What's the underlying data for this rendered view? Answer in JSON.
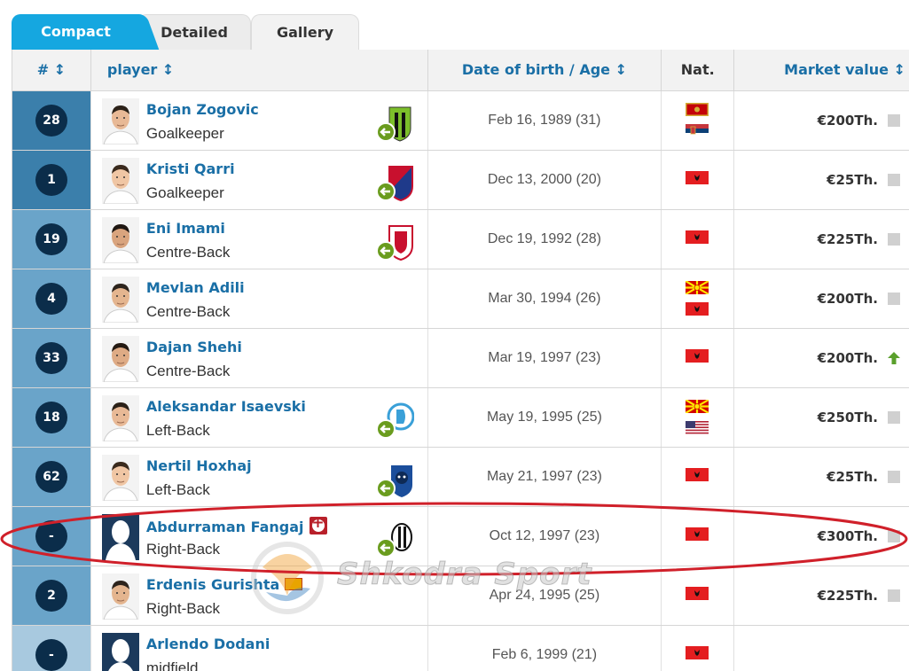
{
  "tabs": [
    {
      "label": "Compact",
      "active": true
    },
    {
      "label": "Detailed",
      "active": false
    },
    {
      "label": "Gallery",
      "active": false
    }
  ],
  "header": {
    "num": "# ↕",
    "player": "player ↕",
    "dob": "Date of birth / Age ↕",
    "nat": "Nat.",
    "mv": "Market value ↕"
  },
  "rows": [
    {
      "num": "28",
      "name": "Bojan Zogovic",
      "position": "Goalkeeper",
      "dob": "Feb 16, 1989 (31)",
      "value": "€200Th.",
      "num_bg": "#3b7fab",
      "flags": [
        "montenegro",
        "serbia"
      ],
      "club": "green-black-club-icon",
      "trend": "none"
    },
    {
      "num": "1",
      "name": "Kristi Qarri",
      "position": "Goalkeeper",
      "dob": "Dec 13, 2000 (20)",
      "value": "€25Th.",
      "num_bg": "#3b7fab",
      "flags": [
        "albania"
      ],
      "club": "red-blue-club-icon",
      "trend": "none"
    },
    {
      "num": "19",
      "name": "Eni Imami",
      "position": "Centre-Back",
      "dob": "Dec 19, 1992 (28)",
      "value": "€225Th.",
      "num_bg": "#6aa4c9",
      "flags": [
        "albania"
      ],
      "club": "red-white-club-icon",
      "trend": "none"
    },
    {
      "num": "4",
      "name": "Mevlan Adili",
      "position": "Centre-Back",
      "dob": "Mar 30, 1994 (26)",
      "value": "€200Th.",
      "num_bg": "#6aa4c9",
      "flags": [
        "north-macedonia",
        "albania"
      ],
      "club": "",
      "trend": "none"
    },
    {
      "num": "33",
      "name": "Dajan Shehi",
      "position": "Centre-Back",
      "dob": "Mar 19, 1997 (23)",
      "value": "€200Th.",
      "num_bg": "#6aa4c9",
      "flags": [
        "albania"
      ],
      "club": "",
      "trend": "up"
    },
    {
      "num": "18",
      "name": "Aleksandar Isaevski",
      "position": "Left-Back",
      "dob": "May 19, 1995 (25)",
      "value": "€250Th.",
      "num_bg": "#6aa4c9",
      "flags": [
        "north-macedonia",
        "usa"
      ],
      "club": "blue-white-club-icon",
      "trend": "none"
    },
    {
      "num": "62",
      "name": "Nertil Hoxhaj",
      "position": "Left-Back",
      "dob": "May 21, 1997 (23)",
      "value": "€25Th.",
      "num_bg": "#6aa4c9",
      "flags": [
        "albania"
      ],
      "club": "blue-panther-club-icon",
      "trend": "none"
    },
    {
      "num": "-",
      "name": "Abdurraman Fangaj",
      "position": "Right-Back",
      "dob": "Oct 12, 1997 (23)",
      "value": "€300Th.",
      "num_bg": "#6aa4c9",
      "flags": [
        "albania"
      ],
      "club": "black-white-club-icon",
      "trend": "none",
      "injury": true,
      "silhouette": true
    },
    {
      "num": "2",
      "name": "Erdenis Gurishta",
      "position": "Right-Back",
      "dob": "Apr 24, 1995 (25)",
      "value": "€225Th.",
      "num_bg": "#6aa4c9",
      "flags": [
        "albania"
      ],
      "club": "",
      "trend": "none",
      "small_flag": true
    },
    {
      "num": "-",
      "name": "Arlendo Dodani",
      "position": "midfield",
      "dob": "Feb 6, 1999 (21)",
      "value": "",
      "num_bg": "#a8c9df",
      "flags": [
        "albania"
      ],
      "club": "",
      "trend": "none",
      "silhouette": true
    }
  ],
  "watermark": {
    "text": "Shkodra Sport"
  },
  "colors": {
    "accent": "#15a7e0",
    "link": "#1a6fa6",
    "badge": "#0b2d4a",
    "highlight_ring": "#d0202a"
  }
}
